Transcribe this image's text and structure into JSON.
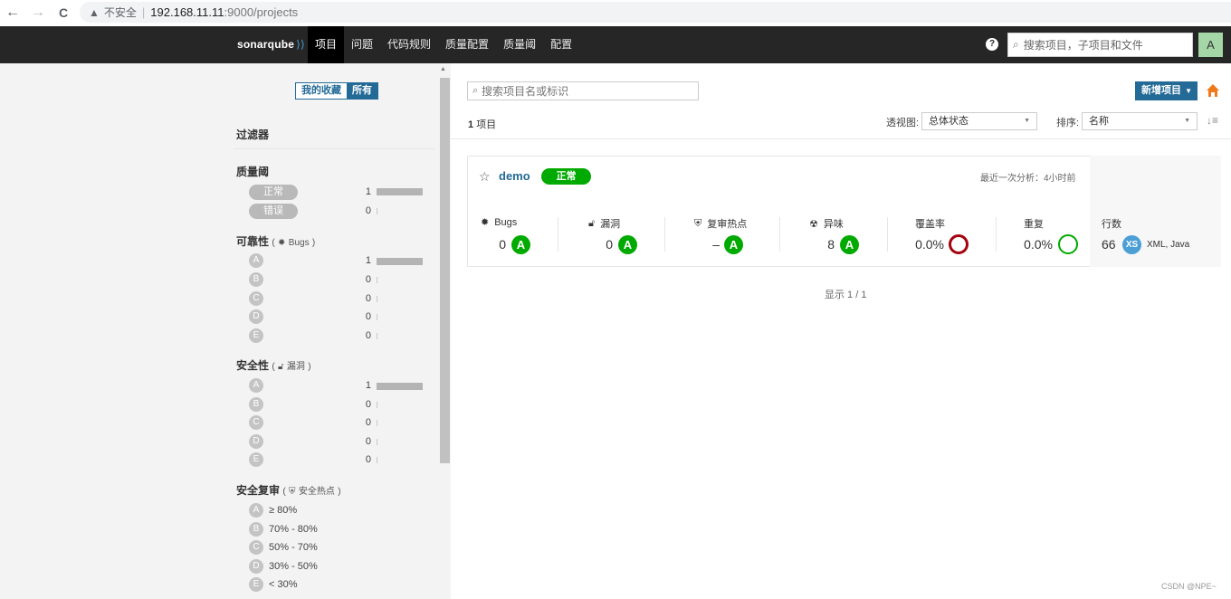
{
  "browser": {
    "back_icon": "←",
    "forward_icon": "→",
    "reload_icon": "C",
    "warning_icon": "▲",
    "insecure_label": "不安全",
    "separator": "|",
    "url_host": "192.168.11.11",
    "url_path": ":9000/projects"
  },
  "topbar": {
    "logo_text": "sonarqube",
    "nav": [
      "项目",
      "问题",
      "代码规则",
      "质量配置",
      "质量阈",
      "配置"
    ],
    "active_nav": "项目",
    "help_glyph": "?",
    "search_placeholder": "搜索项目，子项目和文件",
    "avatar_letter": "A"
  },
  "sidebar": {
    "toggle": {
      "favorites": "我的收藏",
      "all": "所有"
    },
    "filter_title": "过滤器",
    "quality_gate": {
      "title": "质量阈",
      "options": [
        {
          "label": "正常",
          "count": "1",
          "fraction": 1
        },
        {
          "label": "错误",
          "count": "0",
          "fraction": 0
        }
      ]
    },
    "reliability": {
      "title": "可靠性",
      "paren_open": "(",
      "subtitle": "Bugs",
      "paren_close": ")",
      "ratings": [
        {
          "grade": "A",
          "count": "1",
          "fraction": 1
        },
        {
          "grade": "B",
          "count": "0",
          "fraction": 0
        },
        {
          "grade": "C",
          "count": "0",
          "fraction": 0
        },
        {
          "grade": "D",
          "count": "0",
          "fraction": 0
        },
        {
          "grade": "E",
          "count": "0",
          "fraction": 0
        }
      ]
    },
    "security": {
      "title": "安全性",
      "paren_open": "(",
      "subtitle": "漏洞",
      "paren_close": ")",
      "ratings": [
        {
          "grade": "A",
          "count": "1",
          "fraction": 1
        },
        {
          "grade": "B",
          "count": "0",
          "fraction": 0
        },
        {
          "grade": "C",
          "count": "0",
          "fraction": 0
        },
        {
          "grade": "D",
          "count": "0",
          "fraction": 0
        },
        {
          "grade": "E",
          "count": "0",
          "fraction": 0
        }
      ]
    },
    "security_review": {
      "title": "安全复审",
      "paren_open": "(",
      "subtitle": "安全热点",
      "paren_close": ")",
      "ratings": [
        {
          "grade": "A",
          "range": "≥ 80%"
        },
        {
          "grade": "B",
          "range": "70% - 80%"
        },
        {
          "grade": "C",
          "range": "50% - 70%"
        },
        {
          "grade": "D",
          "range": "30% - 50%"
        },
        {
          "grade": "E",
          "range": "< 30%"
        }
      ]
    }
  },
  "main": {
    "search_placeholder": "搜索项目名或标识",
    "new_project_label": "新增项目",
    "home_icon": "home-icon",
    "count_number": "1",
    "count_unit": "项目",
    "perspective_label": "透视图:",
    "perspective_value": "总体状态",
    "sort_label": "排序:",
    "sort_value": "名称",
    "pagination": "显示 1 / 1",
    "project": {
      "name": "demo",
      "quality_gate": "正常",
      "last_analysis": "最近一次分析：4小时前",
      "metrics": {
        "bugs": {
          "label": "Bugs",
          "value": "0",
          "rating": "A"
        },
        "vulnerabilities": {
          "label": "漏洞",
          "value": "0",
          "rating": "A"
        },
        "hotspots": {
          "label": "复审热点",
          "value": "–",
          "rating": "A"
        },
        "code_smells": {
          "label": "异味",
          "value": "8",
          "rating": "A"
        },
        "coverage": {
          "label": "覆盖率",
          "value": "0.0%"
        },
        "duplications": {
          "label": "重复",
          "value": "0.0%"
        },
        "lines": {
          "label": "行数",
          "value": "66",
          "size": "XS",
          "languages": "XML, Java"
        }
      }
    }
  },
  "colors": {
    "brand_blue": "#236a97",
    "passed_green": "#00aa00",
    "coverage_ring": "#a4030f",
    "duplication_ring": "#00aa00",
    "topbar_bg": "#262626"
  },
  "watermark": "CSDN @NPE~"
}
